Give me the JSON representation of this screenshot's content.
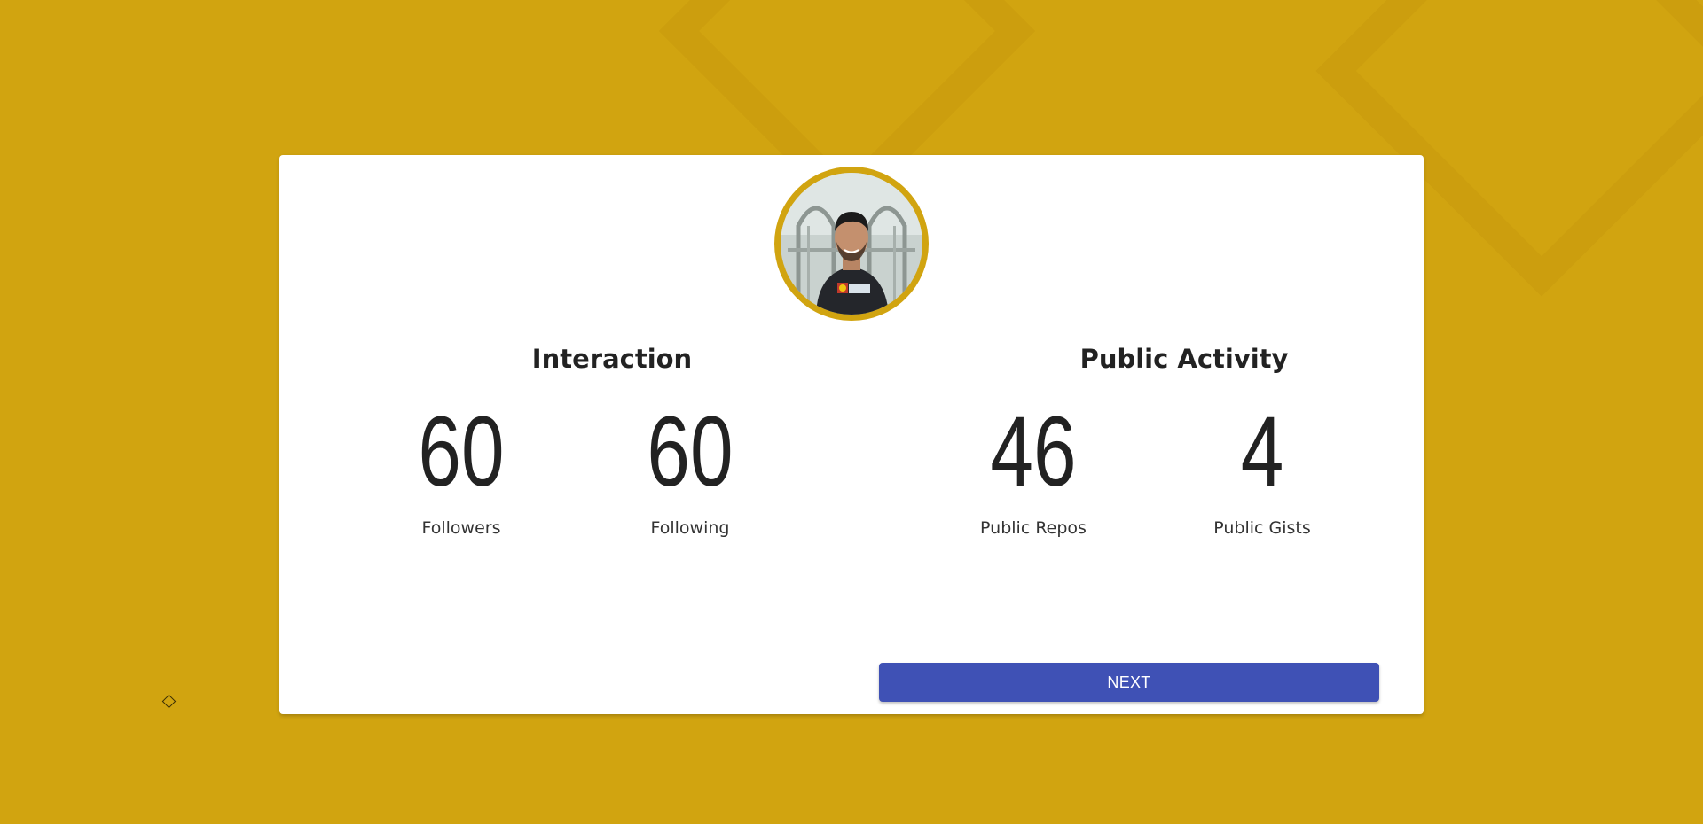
{
  "background": {
    "color": "#D1A410"
  },
  "profile": {
    "avatar_icon": "user-photo-avatar",
    "avatar_ring_color": "#D1A410"
  },
  "interaction": {
    "title": "Interaction",
    "stats": [
      {
        "value": "60",
        "label": "Followers"
      },
      {
        "value": "60",
        "label": "Following"
      }
    ]
  },
  "public_activity": {
    "title": "Public Activity",
    "stats": [
      {
        "value": "46",
        "label": "Public Repos"
      },
      {
        "value": "4",
        "label": "Public Gists"
      }
    ]
  },
  "actions": {
    "next_label": "NEXT",
    "next_color": "#3F51B5"
  },
  "decor": {
    "corner_icon": "diamond-icon"
  }
}
